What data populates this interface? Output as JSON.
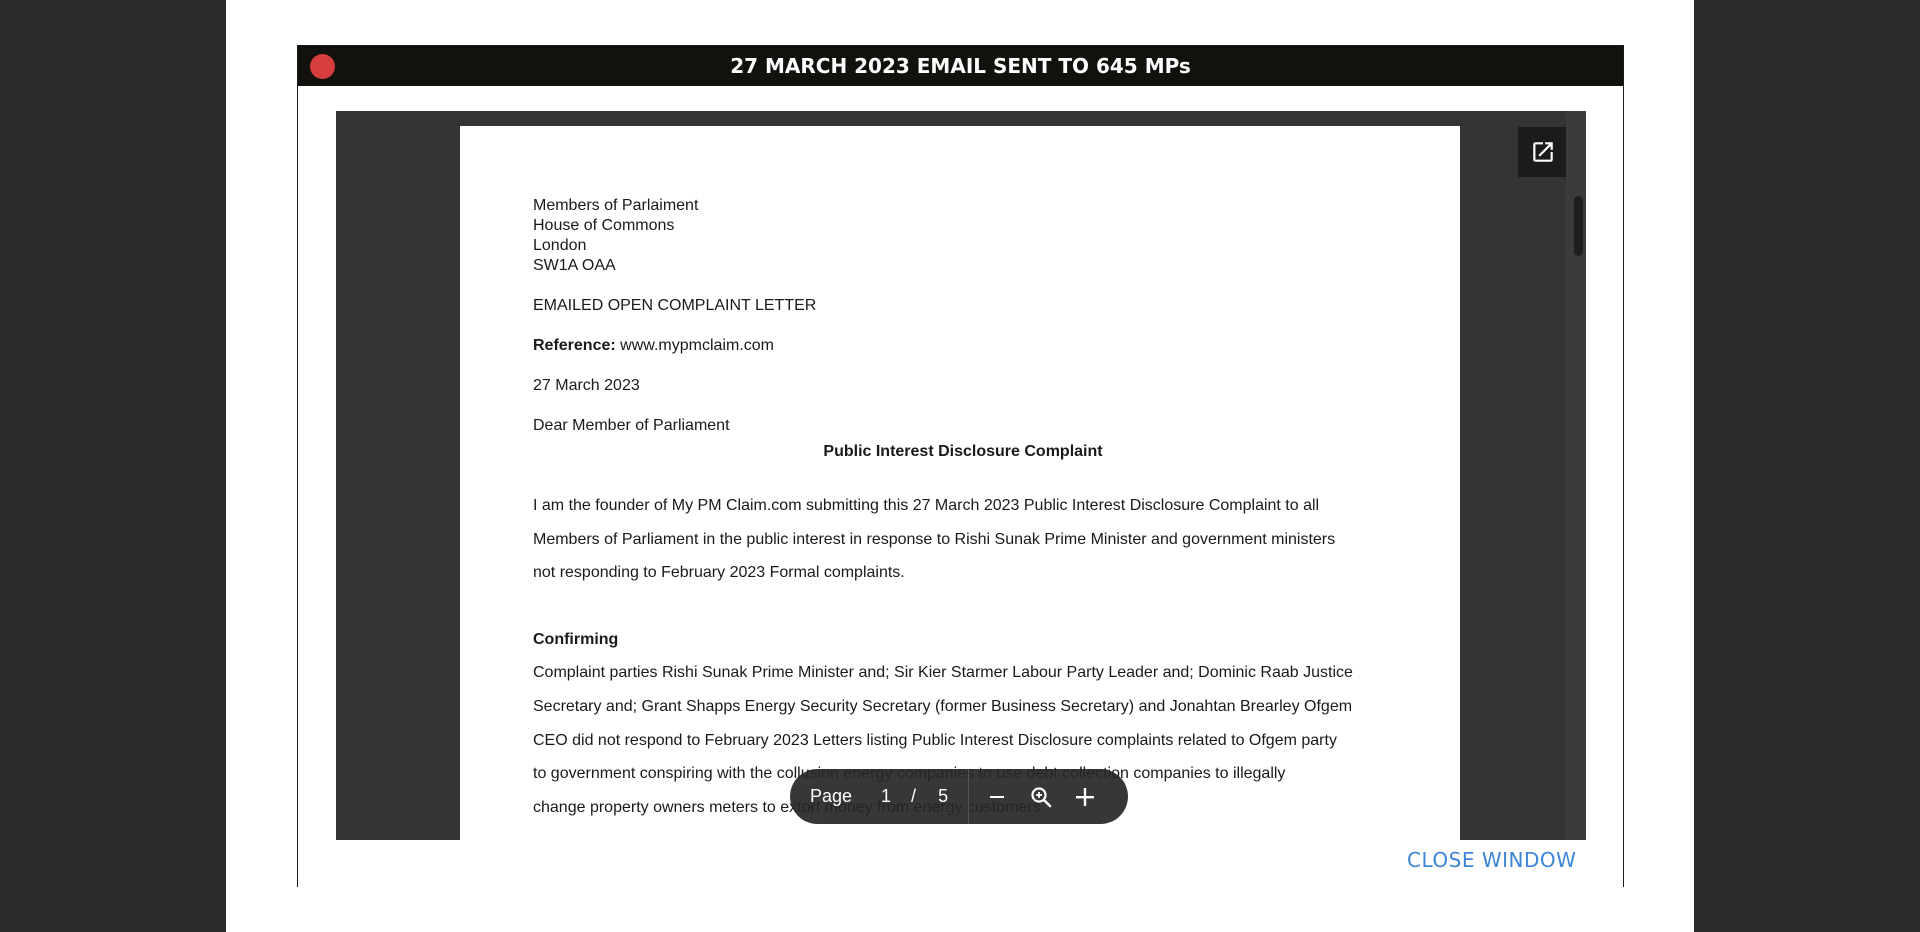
{
  "modal": {
    "title": "27 MARCH 2023 EMAIL SENT TO 645 MPs",
    "close_window_label": "CLOSE WINDOW"
  },
  "viewer": {
    "page_label": "Page",
    "current_page": "1",
    "page_separator": "/",
    "total_pages": "5",
    "icons": [
      "close-dot-icon",
      "open-external-icon",
      "zoom-out-icon",
      "zoom-icon",
      "zoom-in-icon"
    ]
  },
  "letter": {
    "address": [
      "Members of Parlaiment",
      "House of Commons",
      "London",
      "SW1A OAA"
    ],
    "heading": "EMAILED OPEN COMPLAINT LETTER",
    "reference_label": "Reference:",
    "reference_value": "www.mypmclaim.com",
    "date": "27 March 2023",
    "salutation": "Dear Member of Parliament",
    "subject": "Public Interest Disclosure Complaint",
    "intro_lines": [
      "I am the founder of My PM Claim.com submitting this 27 March 2023 Public Interest Disclosure Complaint to all",
      "Members of Parliament in the public interest in response to Rishi Sunak Prime Minister and government ministers",
      "not responding to February 2023 Formal complaints."
    ],
    "confirming_heading": "Confirming",
    "confirming_lines": [
      "Complaint parties Rishi Sunak Prime Minister and; Sir Kier Starmer Labour Party Leader and; Dominic Raab Justice",
      "Secretary and; Grant Shapps Energy Security Secretary (former Business Secretary) and Jonahtan Brearley Ofgem",
      "CEO did not respond to February 2023 Letters listing Public Interest Disclosure complaints related to Ofgem party",
      "to government conspiring with the collusion energy companies to use debt collection companies to illegally",
      "change property owners meters to extort money from energy customers."
    ]
  },
  "colors": {
    "backdrop": "#2b2b2b",
    "titlebar": "#13110d",
    "close_dot": "#d63d3d",
    "viewer_bg": "#343434",
    "link": "#3d86d6"
  }
}
